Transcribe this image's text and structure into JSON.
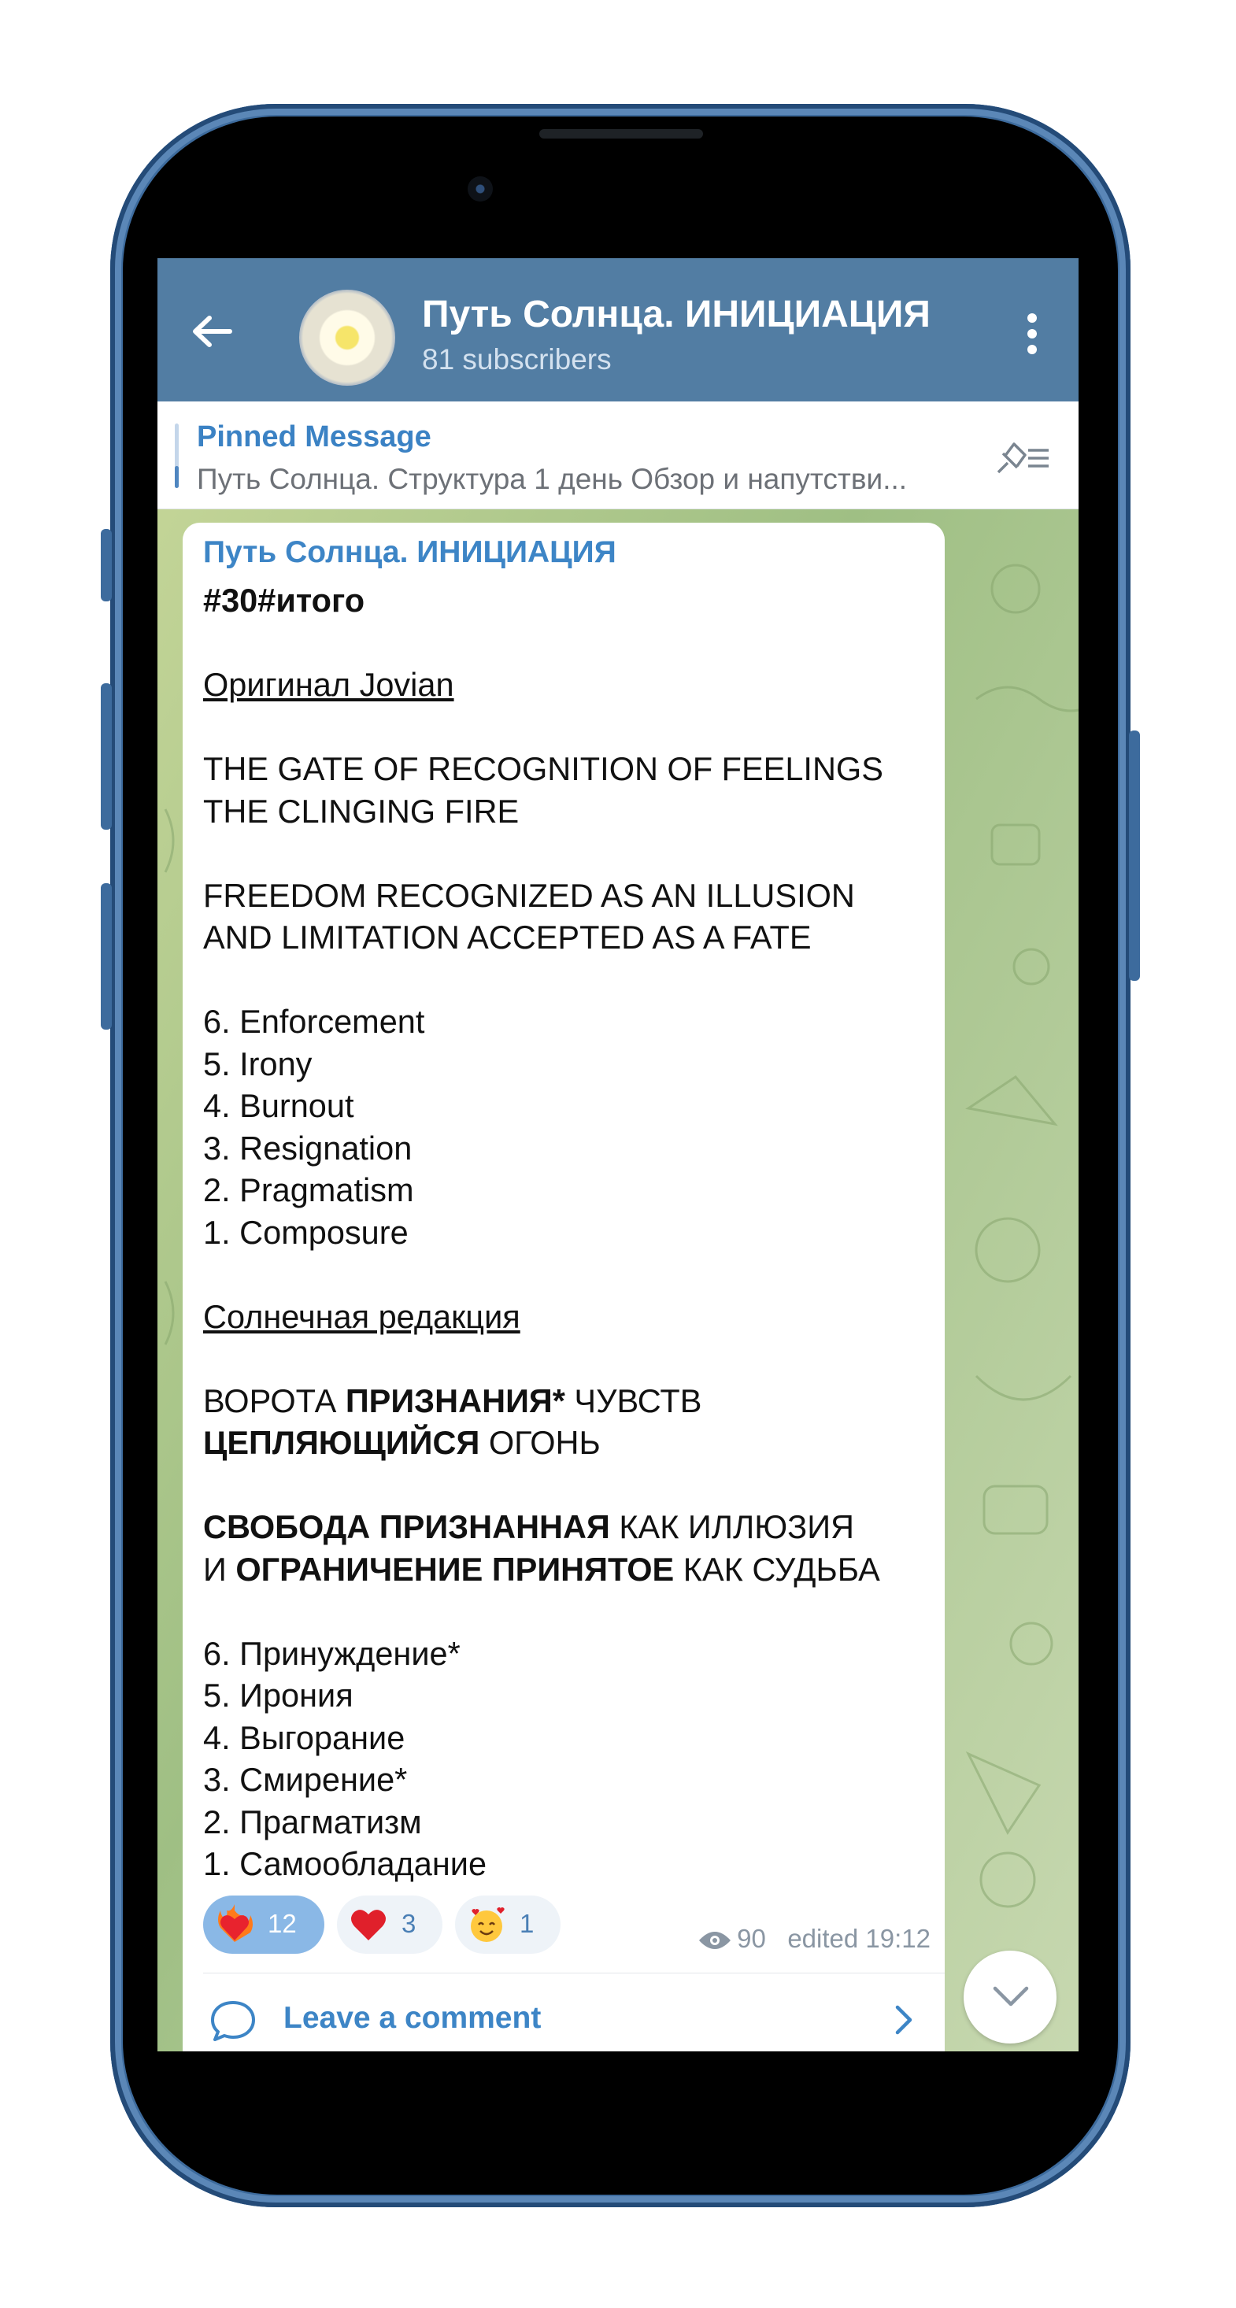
{
  "header": {
    "channel_title": "Путь Солнца. ИНИЦИАЦИЯ",
    "subscribers": "81 subscribers"
  },
  "pinned": {
    "title": "Pinned Message",
    "text": "Путь Солнца. Структура  1 день  Обзор и напутстви..."
  },
  "message": {
    "sender": "Путь Солнца. ИНИЦИАЦИЯ",
    "lines": {
      "l0": "#30#итого",
      "l2": "Оригинал Jovian",
      "l4": "THE GATE OF RECOGNITION OF FEELINGS",
      "l5": "THE CLINGING FIRE",
      "l7": "FREEDOM RECOGNIZED AS AN ILLUSION",
      "l8": "AND LIMITATION ACCEPTED AS A FATE",
      "l10": "6. Enforcement",
      "l11": "5. Irony",
      "l12": "4. Burnout",
      "l13": "3. Resignation",
      "l14": "2. Pragmatism",
      "l15": "1. Composure",
      "l17": "Солнечная редакция",
      "l19a": "ВОРОТА ",
      "l19b": "ПРИЗНАНИЯ*",
      "l19c": " ЧУВСТВ",
      "l20a": "ЦЕПЛЯЮЩИЙСЯ",
      "l20b": " ОГОНЬ",
      "l22a": "СВОБОДА ПРИЗНАННАЯ",
      "l22b": " КАК ИЛЛЮЗИЯ",
      "l23a": "И ",
      "l23b": "ОГРАНИЧЕНИЕ ПРИНЯТОЕ",
      "l23c": " КАК СУДЬБА",
      "l25": "6. Принуждение*",
      "l26": "5. Ирония",
      "l27": "4. Выгорание",
      "l28": "3. Смирение*",
      "l29": "2. Прагматизм",
      "l30": "1. Самообладание"
    },
    "reactions": [
      {
        "emoji": "heart-on-fire",
        "count": "12",
        "active": true
      },
      {
        "emoji": "red-heart",
        "count": "3",
        "active": false
      },
      {
        "emoji": "smiling-face-with-hearts",
        "count": "1",
        "active": false
      }
    ],
    "views": "90",
    "edited": "edited 19:12",
    "comment_label": "Leave a comment"
  },
  "colors": {
    "header_bg": "#527da3",
    "accent": "#3d85c6",
    "reaction_active": "#8ab8e6",
    "wallpaper": "#9fb97e",
    "phone_frame": "#3d6b9d"
  },
  "icons": [
    "back-arrow-icon",
    "more-vert-icon",
    "pin-list-icon",
    "eye-icon",
    "comment-bubble-icon",
    "chevron-right-icon",
    "chevron-down-icon"
  ]
}
